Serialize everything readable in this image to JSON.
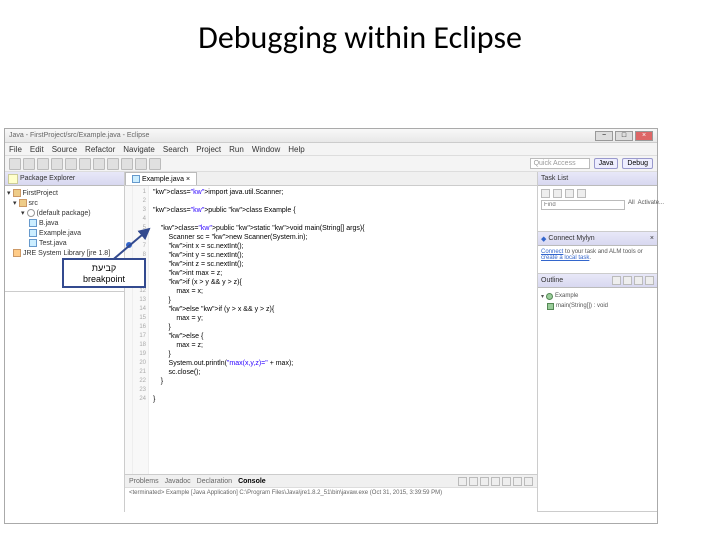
{
  "slide": {
    "title": "Debugging within Eclipse"
  },
  "callout": {
    "line1": "קביעת",
    "line2": "breakpoint"
  },
  "titlebar": {
    "text": "Java - FirstProject/src/Example.java - Eclipse"
  },
  "menubar": [
    "File",
    "Edit",
    "Source",
    "Refactor",
    "Navigate",
    "Search",
    "Project",
    "Run",
    "Window",
    "Help"
  ],
  "quick_access": "Quick Access",
  "perspectives": {
    "java": "Java",
    "debug": "Debug"
  },
  "explorer": {
    "title": "Package Explorer",
    "project": "FirstProject",
    "src": "src",
    "pkg": "(default package)",
    "files": [
      "B.java",
      "Example.java",
      "Test.java"
    ],
    "jre": "JRE System Library [jre 1.8]"
  },
  "editor": {
    "tab": "Example.java",
    "lines": [
      "import java.util.Scanner;",
      "",
      "public class Example {",
      "",
      "    public static void main(String[] args){",
      "        Scanner sc = new Scanner(System.in);",
      "        int x = sc.nextInt();",
      "        int y = sc.nextInt();",
      "        int z = sc.nextInt();",
      "        int max = z;",
      "        if (x > y && y > z){",
      "            max = x;",
      "        }",
      "        else if (y > x && y > z){",
      "            max = y;",
      "        }",
      "        else {",
      "            max = z;",
      "        }",
      "        System.out.println(\"max(x,y,z)=\" + max);",
      "        sc.close();",
      "    }",
      "",
      "}"
    ],
    "breakpoint_at_line": 7
  },
  "task_list": {
    "title": "Task List",
    "find": "Find",
    "all": "All",
    "activate": "Activate..."
  },
  "mylyn": {
    "title": "Connect Mylyn",
    "text": "Connect to your task and ALM tools or create a local task."
  },
  "outline": {
    "title": "Outline",
    "cls": "Example",
    "method": "main(String[]) : void"
  },
  "bottom": {
    "tabs": [
      "Problems",
      "Javadoc",
      "Declaration",
      "Console"
    ],
    "console_text": "<terminated> Example [Java Application] C:\\Program Files\\Java\\jre1.8.2_51\\bin\\javaw.exe (Oct 31, 2015, 3:39:59 PM)"
  }
}
